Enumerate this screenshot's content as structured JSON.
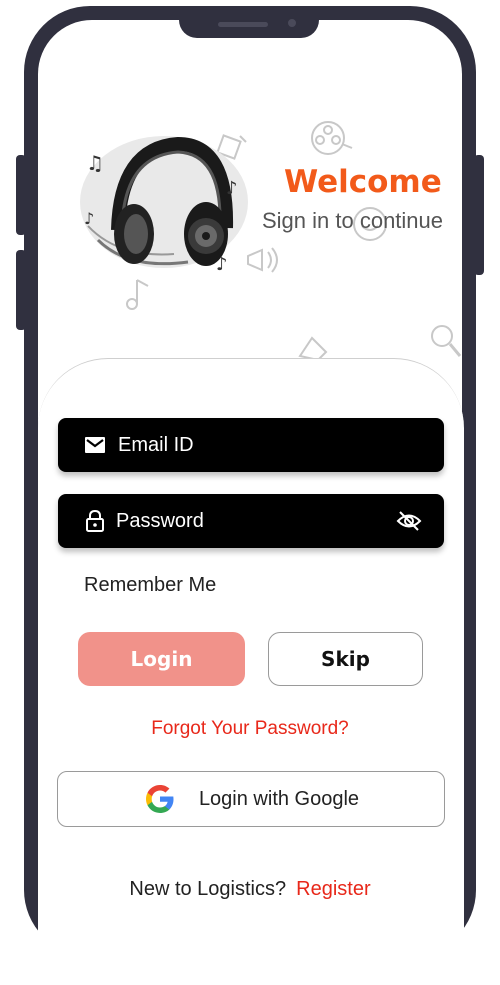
{
  "header": {
    "title": "Welcome",
    "subtitle": "Sign in to continue"
  },
  "login_form": {
    "email_placeholder": "Email ID",
    "password_placeholder": "Password",
    "remember_label": "Remember Me",
    "login_label": "Login",
    "skip_label": "Skip",
    "forgot_label": "Forgot Your Password?",
    "google_label": "Login with Google"
  },
  "footer": {
    "prompt": "New to Logistics?",
    "register_label": "Register"
  },
  "colors": {
    "accent": "#f25a1a",
    "link": "#e8281a",
    "login_button": "#f1928a",
    "frame": "#30303f"
  },
  "icons": [
    "headphones-illustration",
    "mail-icon",
    "lock-icon",
    "eye-off-icon",
    "google-logo-icon"
  ]
}
